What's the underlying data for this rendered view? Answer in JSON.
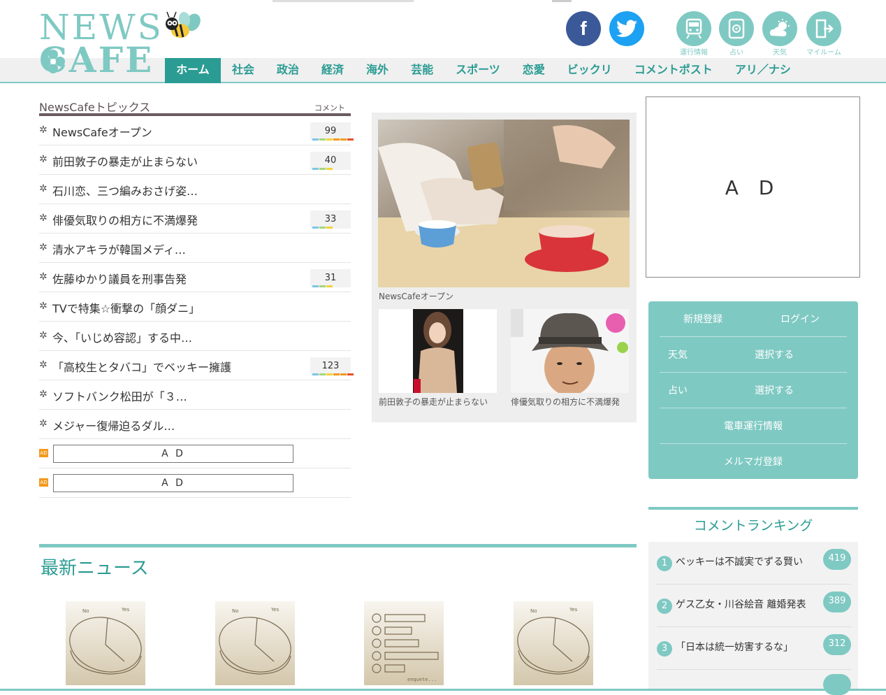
{
  "header": {
    "logo_line1": "NEWS",
    "logo_line2": "CAFE",
    "social": {
      "facebook": "f",
      "twitter": "twitter"
    },
    "utilities": [
      {
        "label": "運行情報",
        "icon": "train-icon"
      },
      {
        "label": "占い",
        "icon": "fortune-icon"
      },
      {
        "label": "天気",
        "icon": "weather-icon"
      },
      {
        "label": "マイルーム",
        "icon": "myroom-icon"
      }
    ]
  },
  "nav": [
    "ホーム",
    "社会",
    "政治",
    "経済",
    "海外",
    "芸能",
    "スポーツ",
    "恋愛",
    "ビックリ",
    "コメントポスト",
    "アリ／ナシ"
  ],
  "topics": {
    "title": "NewsCafeトピックス",
    "comment_label": "コメント",
    "items": [
      {
        "text": "NewsCafeオープン",
        "count": "99"
      },
      {
        "text": "前田敦子の暴走が止まらない",
        "count": "40"
      },
      {
        "text": "石川恋、三つ編みおさげ姿…",
        "count": ""
      },
      {
        "text": "俳優気取りの相方に不満爆発",
        "count": "33"
      },
      {
        "text": "清水アキラが韓国メディ…",
        "count": ""
      },
      {
        "text": "佐藤ゆかり議員を刑事告発",
        "count": "31"
      },
      {
        "text": "TVで特集☆衝撃の「顔ダニ」",
        "count": ""
      },
      {
        "text": "今、「いじめ容認」する中…",
        "count": ""
      },
      {
        "text": "「高校生とタバコ」でベッキー擁護",
        "count": "123"
      },
      {
        "text": "ソフトバンク松田が「３…",
        "count": ""
      },
      {
        "text": "メジャー復帰迫るダル…",
        "count": ""
      }
    ],
    "ads": [
      "A D",
      "A D"
    ],
    "ad_icon": "AD"
  },
  "feature": {
    "main_caption": "NewsCafeオープン",
    "sub1_caption": "前田敦子の暴走が止まらない",
    "sub2_caption": "俳優気取りの相方に不満爆発"
  },
  "sidebar": {
    "ad": "A D",
    "member": {
      "register": "新規登録",
      "login": "ログイン",
      "weather": "天気",
      "weather_select": "選択する",
      "fortune": "占い",
      "fortune_select": "選択する",
      "train": "電車運行情報",
      "mailmag": "メルマガ登録"
    },
    "ranking": {
      "title": "コメントランキング",
      "items": [
        {
          "rank": "1",
          "text": "ベッキーは不誠実でずる賢い",
          "count": "419"
        },
        {
          "rank": "2",
          "text": "ゲス乙女・川谷絵音  離婚発表",
          "count": "389"
        },
        {
          "rank": "3",
          "text": "「日本は統一妨害するな」",
          "count": "312"
        }
      ]
    }
  },
  "latest": {
    "title": "最新ニュース",
    "thumb_labels": {
      "no": "No",
      "yes": "Yes",
      "enquete": "enquete..."
    }
  },
  "colors": {
    "accent": "#7fc9c3",
    "accent_dark": "#2b9c93",
    "facebook": "#3b5998",
    "twitter": "#1da1f2",
    "ad_orange": "#f39a1e"
  }
}
